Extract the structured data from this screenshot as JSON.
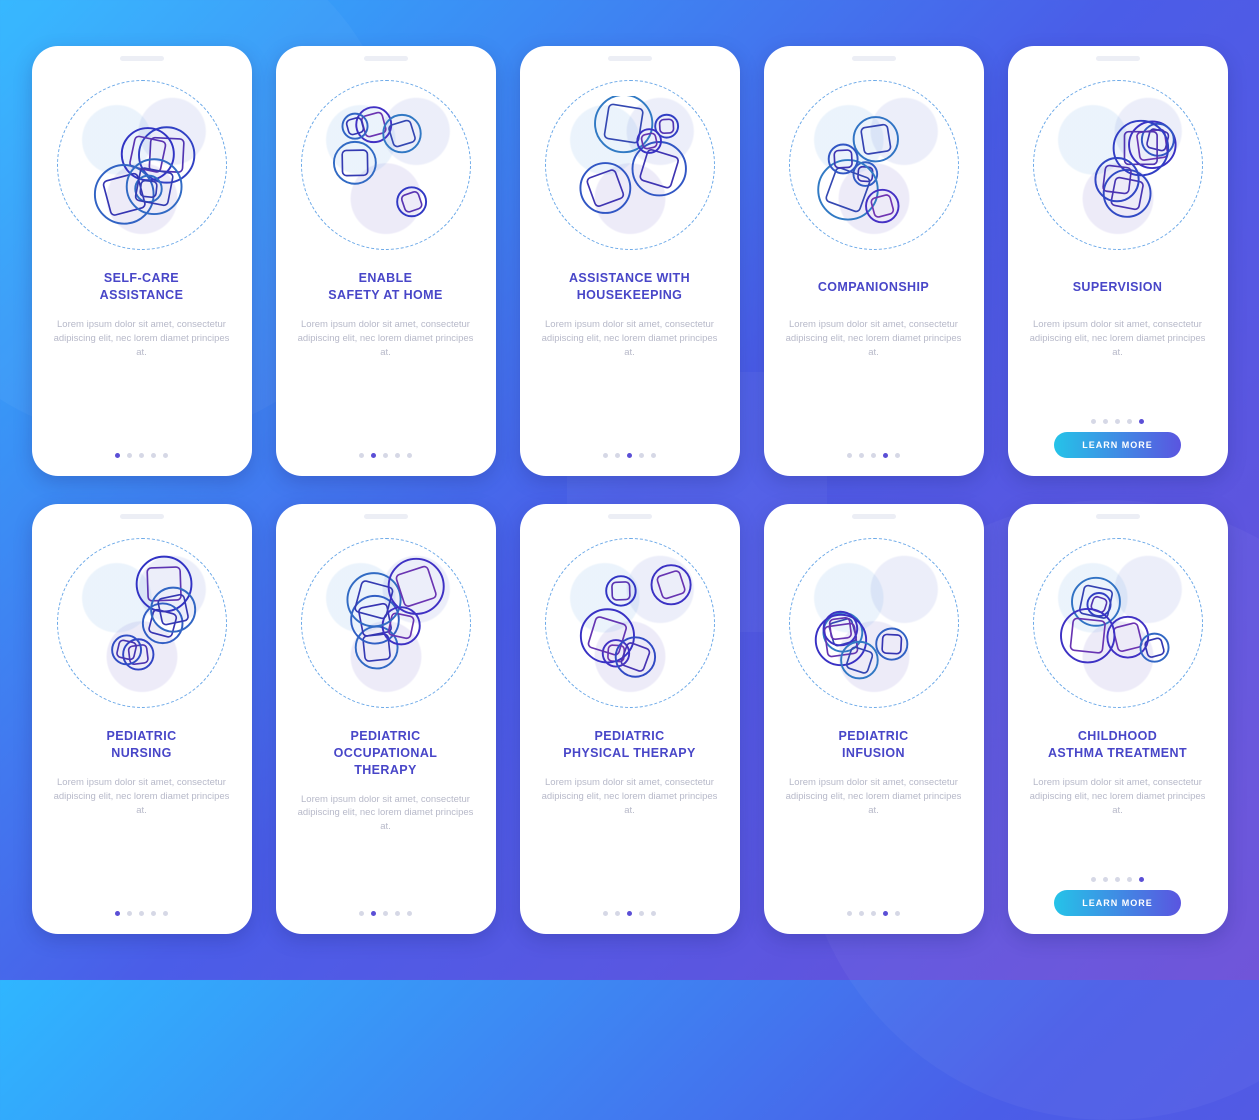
{
  "lorem": "Lorem ipsum dolor sit amet, consectetur adipiscing elit, nec lorem diamet principes at.",
  "cta_label": "LEARN MORE",
  "dot_count": 5,
  "cards": [
    {
      "title": "SELF-CARE\nASSISTANCE",
      "active_dot": 0,
      "has_cta": false,
      "icon": "self-care-icon"
    },
    {
      "title": "ENABLE\nSAFETY AT HOME",
      "active_dot": 1,
      "has_cta": false,
      "icon": "safety-home-icon"
    },
    {
      "title": "ASSISTANCE WITH\nHOUSEKEEPING",
      "active_dot": 2,
      "has_cta": false,
      "icon": "housekeeping-icon"
    },
    {
      "title": "COMPANIONSHIP",
      "active_dot": 3,
      "has_cta": false,
      "icon": "companionship-icon"
    },
    {
      "title": "SUPERVISION",
      "active_dot": 4,
      "has_cta": true,
      "icon": "supervision-icon"
    },
    {
      "title": "PEDIATRIC\nNURSING",
      "active_dot": 0,
      "has_cta": false,
      "icon": "pediatric-nursing-icon"
    },
    {
      "title": "PEDIATRIC\nOCCUPATIONAL\nTHERAPY",
      "active_dot": 1,
      "has_cta": false,
      "icon": "occupational-therapy-icon"
    },
    {
      "title": "PEDIATRIC\nPHYSICAL THERAPY",
      "active_dot": 2,
      "has_cta": false,
      "icon": "physical-therapy-icon"
    },
    {
      "title": "PEDIATRIC\nINFUSION",
      "active_dot": 3,
      "has_cta": false,
      "icon": "pediatric-infusion-icon"
    },
    {
      "title": "CHILDHOOD\nASTHMA TREATMENT",
      "active_dot": 4,
      "has_cta": true,
      "icon": "asthma-treatment-icon"
    }
  ]
}
